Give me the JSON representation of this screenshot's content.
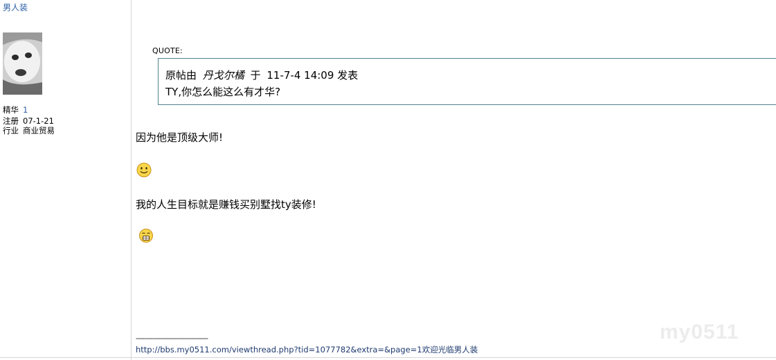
{
  "author": {
    "username": "男人装",
    "avatar_icon": "baby-photo-avatar",
    "fields": [
      {
        "label": "精华",
        "value": "1"
      },
      {
        "label": "注册",
        "value": "07-1-21"
      },
      {
        "label": "行业",
        "value": "商业贸易"
      }
    ]
  },
  "quote": {
    "label": "QUOTE:",
    "prefix": "原帖由",
    "author": "丹戈尔橘",
    "at": "于",
    "date": "11-7-4 14:09",
    "suffix": "发表",
    "text": "TY,你怎么能这么有才华?"
  },
  "post": {
    "line1": "因为他是顶级大师!",
    "emoticon1": "smile-emoticon",
    "line2": "我的人生目标就是赚钱买别墅找ty装修!",
    "emoticon2": "grin-emoticon"
  },
  "signature": {
    "divider": "-----------------------------------",
    "url": "http://bbs.my0511.com/viewthread.php?tid=1077782&extra=&page=1",
    "tagline": "欢迎光临男人装"
  },
  "colors": {
    "link": "#2a5fa5",
    "quote_border": "#4e7f8f",
    "divider": "#d6d6d6"
  }
}
